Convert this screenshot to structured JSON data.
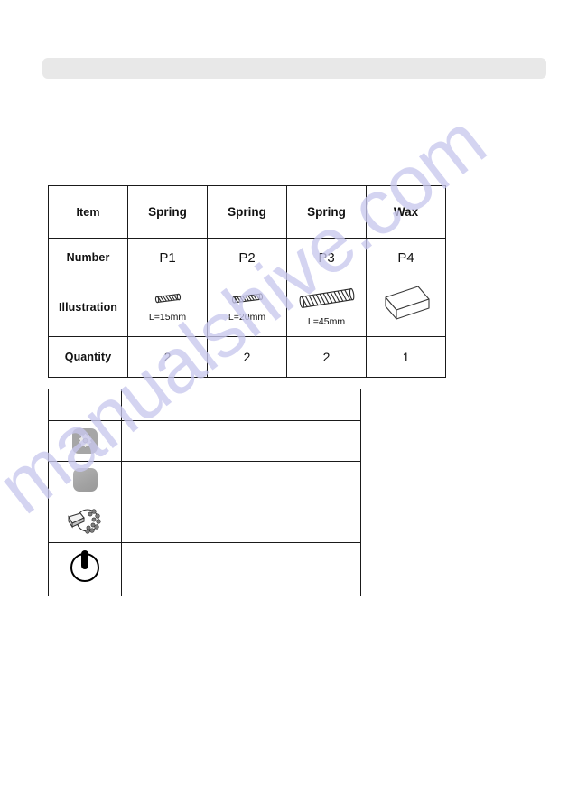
{
  "page": {
    "watermark_text": "manualshive.com",
    "watermark_color": "#c9c8ee",
    "background_color": "#ffffff",
    "topbar_color": "#e8e8e8"
  },
  "parts_table": {
    "row_labels": [
      "Item",
      "Number",
      "Illustration",
      "Quantity"
    ],
    "columns": [
      {
        "item": "Spring",
        "number": "P1",
        "illustration_icon": "spring-coil-icon",
        "illustration_length": "L=15mm",
        "quantity": "2"
      },
      {
        "item": "Spring",
        "number": "P2",
        "illustration_icon": "spring-coil-icon",
        "illustration_length": "L=20mm",
        "quantity": "2"
      },
      {
        "item": "Spring",
        "number": "P3",
        "illustration_icon": "spring-coil-icon",
        "illustration_length": "L=45mm",
        "quantity": "2"
      },
      {
        "item": "Wax",
        "number": "P4",
        "illustration_icon": "wax-block-icon",
        "illustration_length": "",
        "quantity": "1"
      }
    ]
  },
  "legend_table": {
    "rows": [
      {
        "icon": "",
        "description": ""
      },
      {
        "icon": "flower-knob-button-icon",
        "description": ""
      },
      {
        "icon": "rounded-square-button-icon",
        "description": ""
      },
      {
        "icon": "gear-tool-icon",
        "description": ""
      },
      {
        "icon": "power-switch-icon",
        "description": ""
      }
    ]
  }
}
